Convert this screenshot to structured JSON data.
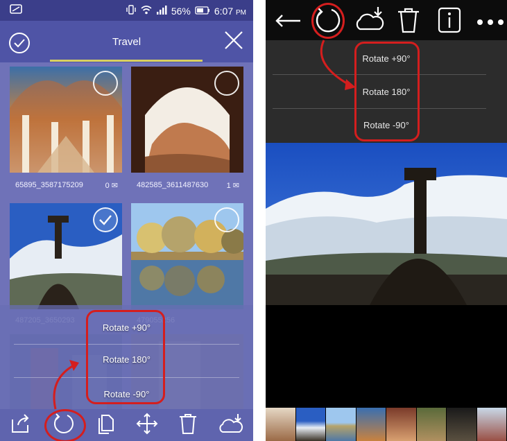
{
  "status_bar": {
    "battery_percent": "56%",
    "time": "6:07",
    "ampm": "PM"
  },
  "album": {
    "title": "Travel"
  },
  "grid": {
    "captions": [
      {
        "name": "65895_3587175209",
        "count": "0"
      },
      {
        "name": "482585_3611487630",
        "count": "1"
      },
      {
        "name": "487205_3650293",
        "count": ""
      },
      {
        "name": "479055256",
        "count": ""
      }
    ]
  },
  "rotate_menu": {
    "items": [
      "Rotate +90°",
      "Rotate 180°",
      "Rotate -90°"
    ]
  },
  "bottom_toolbar": {
    "icons": [
      "share-icon",
      "rotate-icon",
      "copy-icon",
      "move-icon",
      "trash-icon",
      "cloud-download-icon"
    ]
  },
  "viewer": {
    "top_icons": [
      "back-arrow-icon",
      "rotate-icon",
      "cloud-download-icon",
      "trash-icon",
      "info-icon",
      "more-icon"
    ],
    "rotate_menu": [
      "Rotate +90°",
      "Rotate 180°",
      "Rotate -90°"
    ]
  },
  "colors": {
    "highlight": "#d41e1e",
    "app_bar": "#4f54a6",
    "background": "#6f72b8"
  }
}
